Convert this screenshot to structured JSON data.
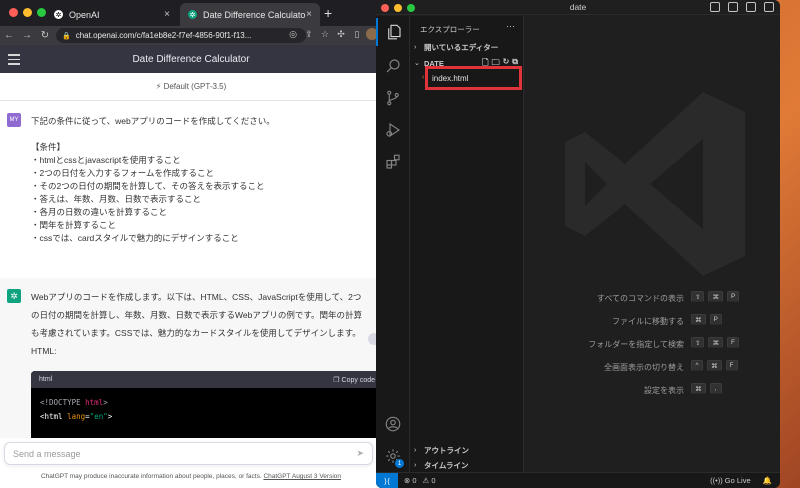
{
  "chrome": {
    "tabs": [
      {
        "label": "OpenAI"
      },
      {
        "label": "Date Difference Calculator"
      }
    ],
    "new_tab": "+",
    "close": "×",
    "address": "chat.openai.com/c/fa1eb8e2-f7ef-4856-90f1-f13...",
    "header_title": "Date Difference Calculator"
  },
  "chat": {
    "model": "Default (GPT-3.5)",
    "user_avatar": "MY",
    "user_message": [
      "下記の条件に従って、webアプリのコードを作成してください。",
      "",
      "【条件】",
      "・htmlとcssとjavascriptを使用すること",
      "・2つの日付を入力するフォームを作成すること",
      "・その2つの日付の期間を計算して、その答えを表示すること",
      "・答えは、年数、月数、日数で表示すること",
      "・各月の日数の違いを計算すること",
      "・閏年を計算すること",
      "・cssでは、cardスタイルで魅力的にデザインすること"
    ],
    "ai_message": [
      "Webアプリのコードを作成します。以下は、HTML、CSS、JavaScriptを使用して、2つ",
      "の日付の期間を計算し、年数、月数、日数で表示するWebアプリの例です。閏年の計算",
      "も考慮されています。CSSでは、魅力的なカードスタイルを使用してデザインします。"
    ],
    "html_label": "HTML:",
    "code": {
      "lang": "html",
      "copy_label": "Copy code",
      "doctype": "<!DOCTYPE",
      "doctype_kw": "html",
      "doctype_end": ">",
      "tag_open": "<html",
      "attr": "lang",
      "eq": "=",
      "attr_val": "\"en\"",
      "tag_close": ">"
    },
    "input_placeholder": "Send a message",
    "footer_text": "ChatGPT may produce inaccurate information about people, places, or facts.",
    "footer_link": "ChatGPT August 3 Version"
  },
  "vscode": {
    "window_title": "date",
    "explorer_title": "エクスプローラー",
    "more": "···",
    "open_editors": "開いているエディター",
    "folder": "DATE",
    "file": "index.html",
    "outline": "アウトライン",
    "timeline": "タイムライン",
    "settings_badge": "1",
    "shortcuts": [
      {
        "label": "すべてのコマンドの表示",
        "keys": [
          "⇧",
          "⌘",
          "P"
        ]
      },
      {
        "label": "ファイルに移動する",
        "keys": [
          "⌘",
          "P"
        ]
      },
      {
        "label": "フォルダーを指定して検索",
        "keys": [
          "⇧",
          "⌘",
          "F"
        ]
      },
      {
        "label": "全画面表示の切り替え",
        "keys": [
          "^",
          "⌘",
          "F"
        ]
      },
      {
        "label": "設定を表示",
        "keys": [
          "⌘",
          ","
        ]
      }
    ],
    "status": {
      "errors": "⊗ 0",
      "warnings": "⚠ 0",
      "go_live": "Go Live"
    }
  }
}
